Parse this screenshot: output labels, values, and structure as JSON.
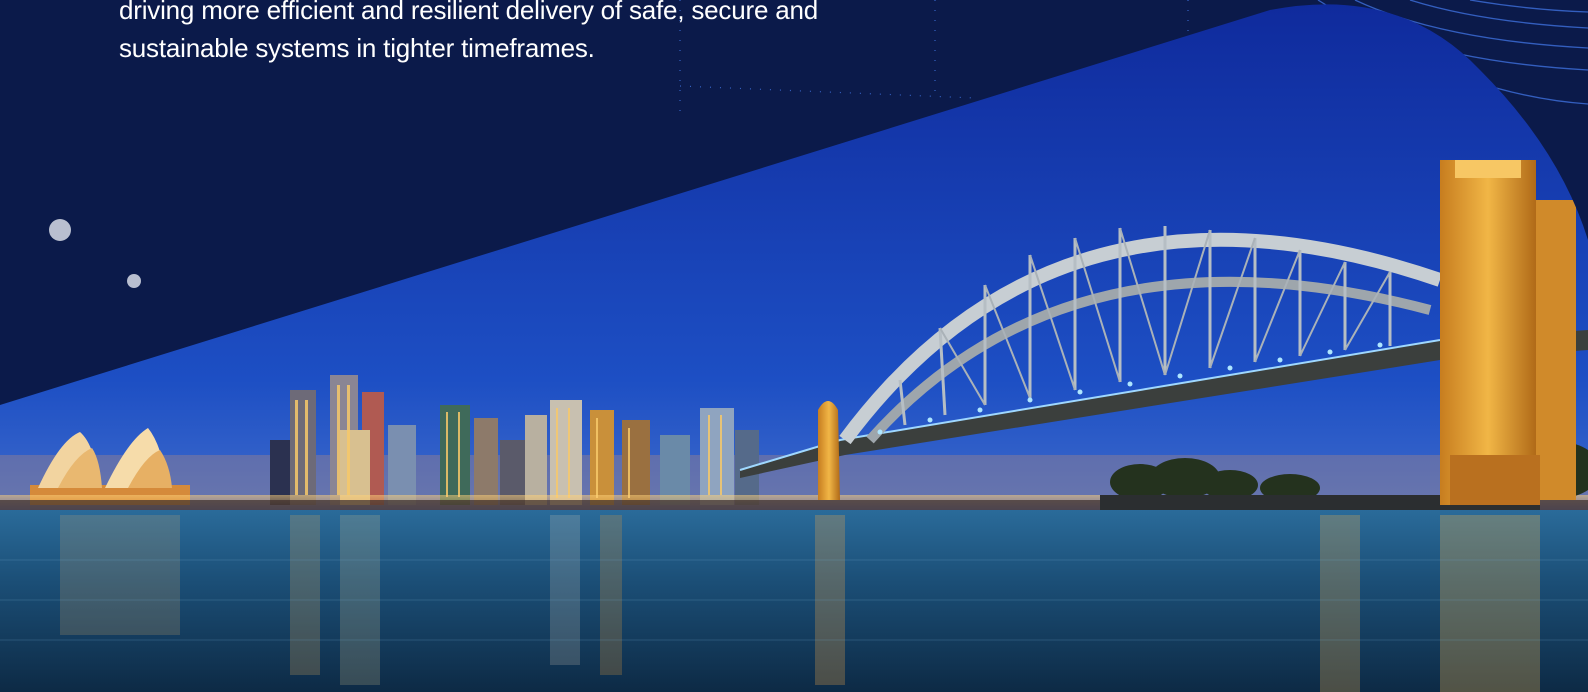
{
  "intro": {
    "line1": "driving more efficient and resilient delivery of safe, secure and",
    "line2": "sustainable systems in tighter timeframes."
  },
  "image": {
    "subject": "Sydney Harbour Bridge and city skyline at dusk"
  },
  "colors": {
    "navy_background": "#0b1a4a",
    "text": "#ffffff",
    "dot": "#b9bfd0",
    "sky_top": "#1230a8",
    "sky_horizon": "#5f79c8",
    "water": "#1c4d78",
    "city_lights": "#f2b34a"
  }
}
